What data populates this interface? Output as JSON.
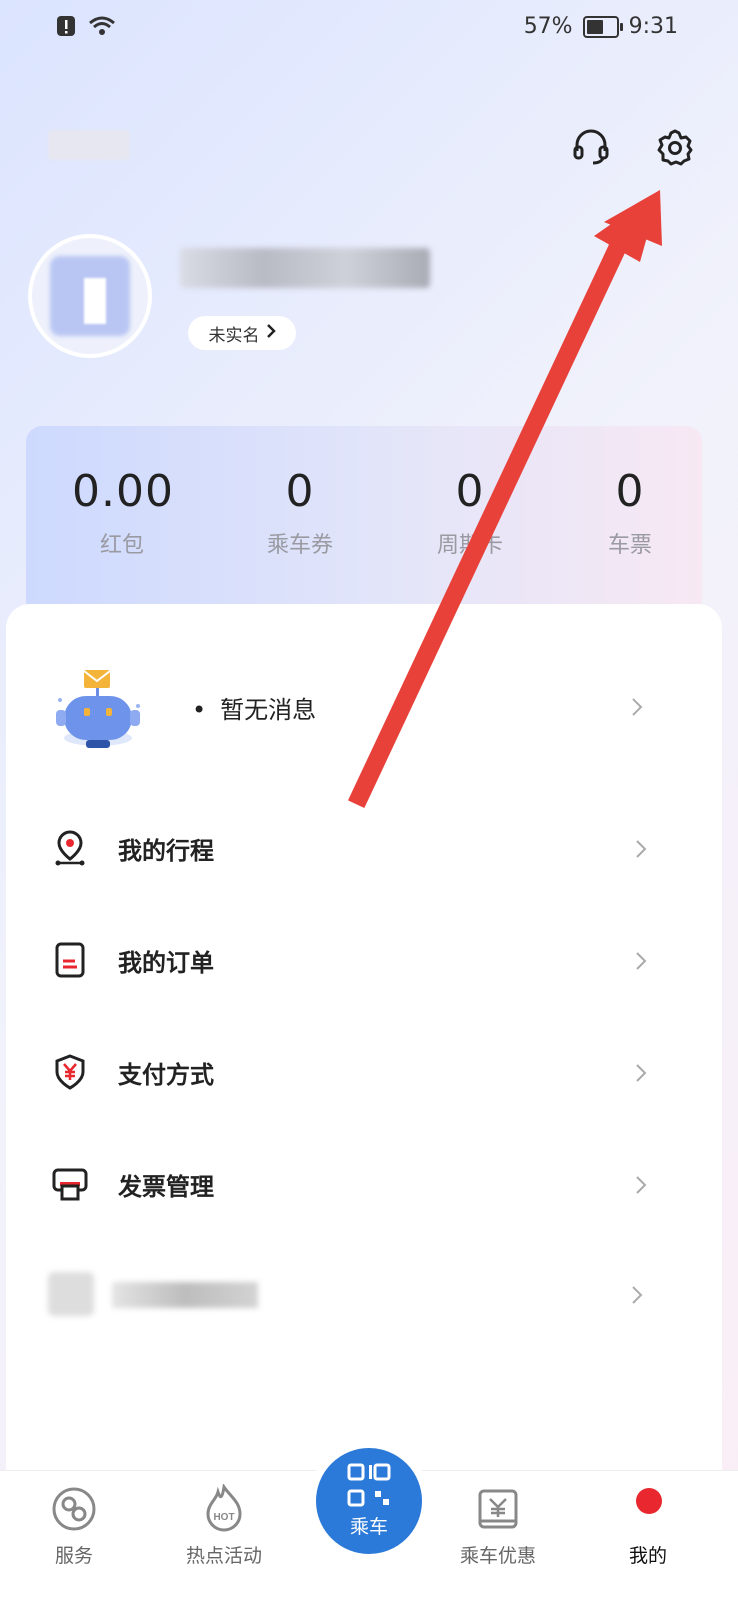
{
  "status_bar": {
    "battery": "57%",
    "battery_level": 0.57,
    "time": "9:31"
  },
  "profile": {
    "verify_label": "未实名"
  },
  "stats": [
    {
      "value": "0.00",
      "label": "红包"
    },
    {
      "value": "0",
      "label": "乘车券"
    },
    {
      "value": "0",
      "label": "周期卡"
    },
    {
      "value": "0",
      "label": "车票"
    }
  ],
  "messages": {
    "text": "暂无消息"
  },
  "menu": [
    {
      "label": "我的行程",
      "icon": "location-pin-icon"
    },
    {
      "label": "我的订单",
      "icon": "order-icon"
    },
    {
      "label": "支付方式",
      "icon": "yen-shield-icon"
    },
    {
      "label": "发票管理",
      "icon": "printer-icon"
    }
  ],
  "nav": {
    "items": [
      {
        "label": "服务",
        "icon": "service-icon"
      },
      {
        "label": "热点活动",
        "icon": "hot-icon"
      },
      {
        "label": "乘车",
        "icon": "qr-code-icon"
      },
      {
        "label": "乘车优惠",
        "icon": "discount-icon"
      },
      {
        "label": "我的",
        "icon": "profile-icon"
      }
    ]
  },
  "colors": {
    "accent": "#2b79d8",
    "arrow": "#e8413a",
    "badge": "#e8282e"
  }
}
